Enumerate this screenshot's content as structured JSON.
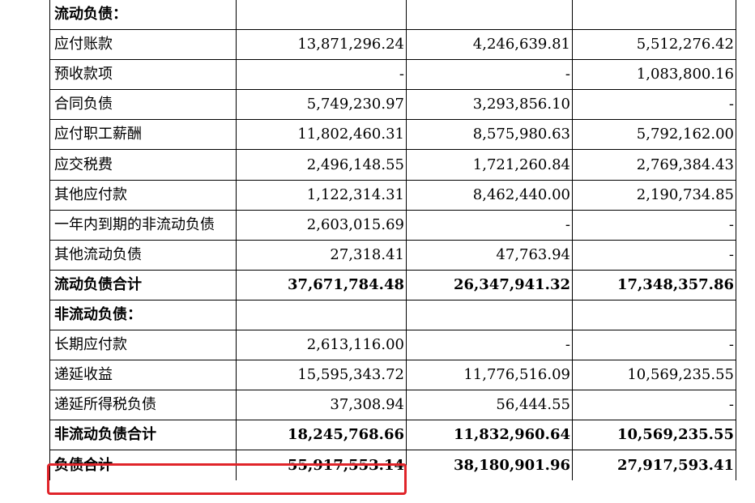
{
  "rows": [
    {
      "label": "流动负债：",
      "v1": "",
      "v2": "",
      "v3": "",
      "bold": true
    },
    {
      "label": "应付账款",
      "v1": "13,871,296.24",
      "v2": "4,246,639.81",
      "v3": "5,512,276.42",
      "bold": false
    },
    {
      "label": "预收款项",
      "v1": "-",
      "v2": "-",
      "v3": "1,083,800.16",
      "bold": false
    },
    {
      "label": "合同负债",
      "v1": "5,749,230.97",
      "v2": "3,293,856.10",
      "v3": "-",
      "bold": false
    },
    {
      "label": "应付职工薪酬",
      "v1": "11,802,460.31",
      "v2": "8,575,980.63",
      "v3": "5,792,162.00",
      "bold": false
    },
    {
      "label": "应交税费",
      "v1": "2,496,148.55",
      "v2": "1,721,260.84",
      "v3": "2,769,384.43",
      "bold": false
    },
    {
      "label": "其他应付款",
      "v1": "1,122,314.31",
      "v2": "8,462,440.00",
      "v3": "2,190,734.85",
      "bold": false
    },
    {
      "label": "一年内到期的非流动负债",
      "v1": "2,603,015.69",
      "v2": "-",
      "v3": "-",
      "bold": false
    },
    {
      "label": "其他流动负债",
      "v1": "27,318.41",
      "v2": "47,763.94",
      "v3": "-",
      "bold": false
    },
    {
      "label": "流动负债合计",
      "v1": "37,671,784.48",
      "v2": "26,347,941.32",
      "v3": "17,348,357.86",
      "bold": true
    },
    {
      "label": "非流动负债：",
      "v1": "",
      "v2": "",
      "v3": "",
      "bold": true
    },
    {
      "label": "长期应付款",
      "v1": "2,613,116.00",
      "v2": "-",
      "v3": "-",
      "bold": false
    },
    {
      "label": "递延收益",
      "v1": "15,595,343.72",
      "v2": "11,776,516.09",
      "v3": "10,569,235.55",
      "bold": false
    },
    {
      "label": "递延所得税负债",
      "v1": "37,308.94",
      "v2": "56,444.55",
      "v3": "-",
      "bold": false
    },
    {
      "label": "非流动负债合计",
      "v1": "18,245,768.66",
      "v2": "11,832,960.64",
      "v3": "10,569,235.55",
      "bold": true
    },
    {
      "label": "负债合计",
      "v1": "55,917,553.14",
      "v2": "38,180,901.96",
      "v3": "27,917,593.41",
      "bold": true
    }
  ],
  "highlight": {
    "color": "#e0242a"
  }
}
